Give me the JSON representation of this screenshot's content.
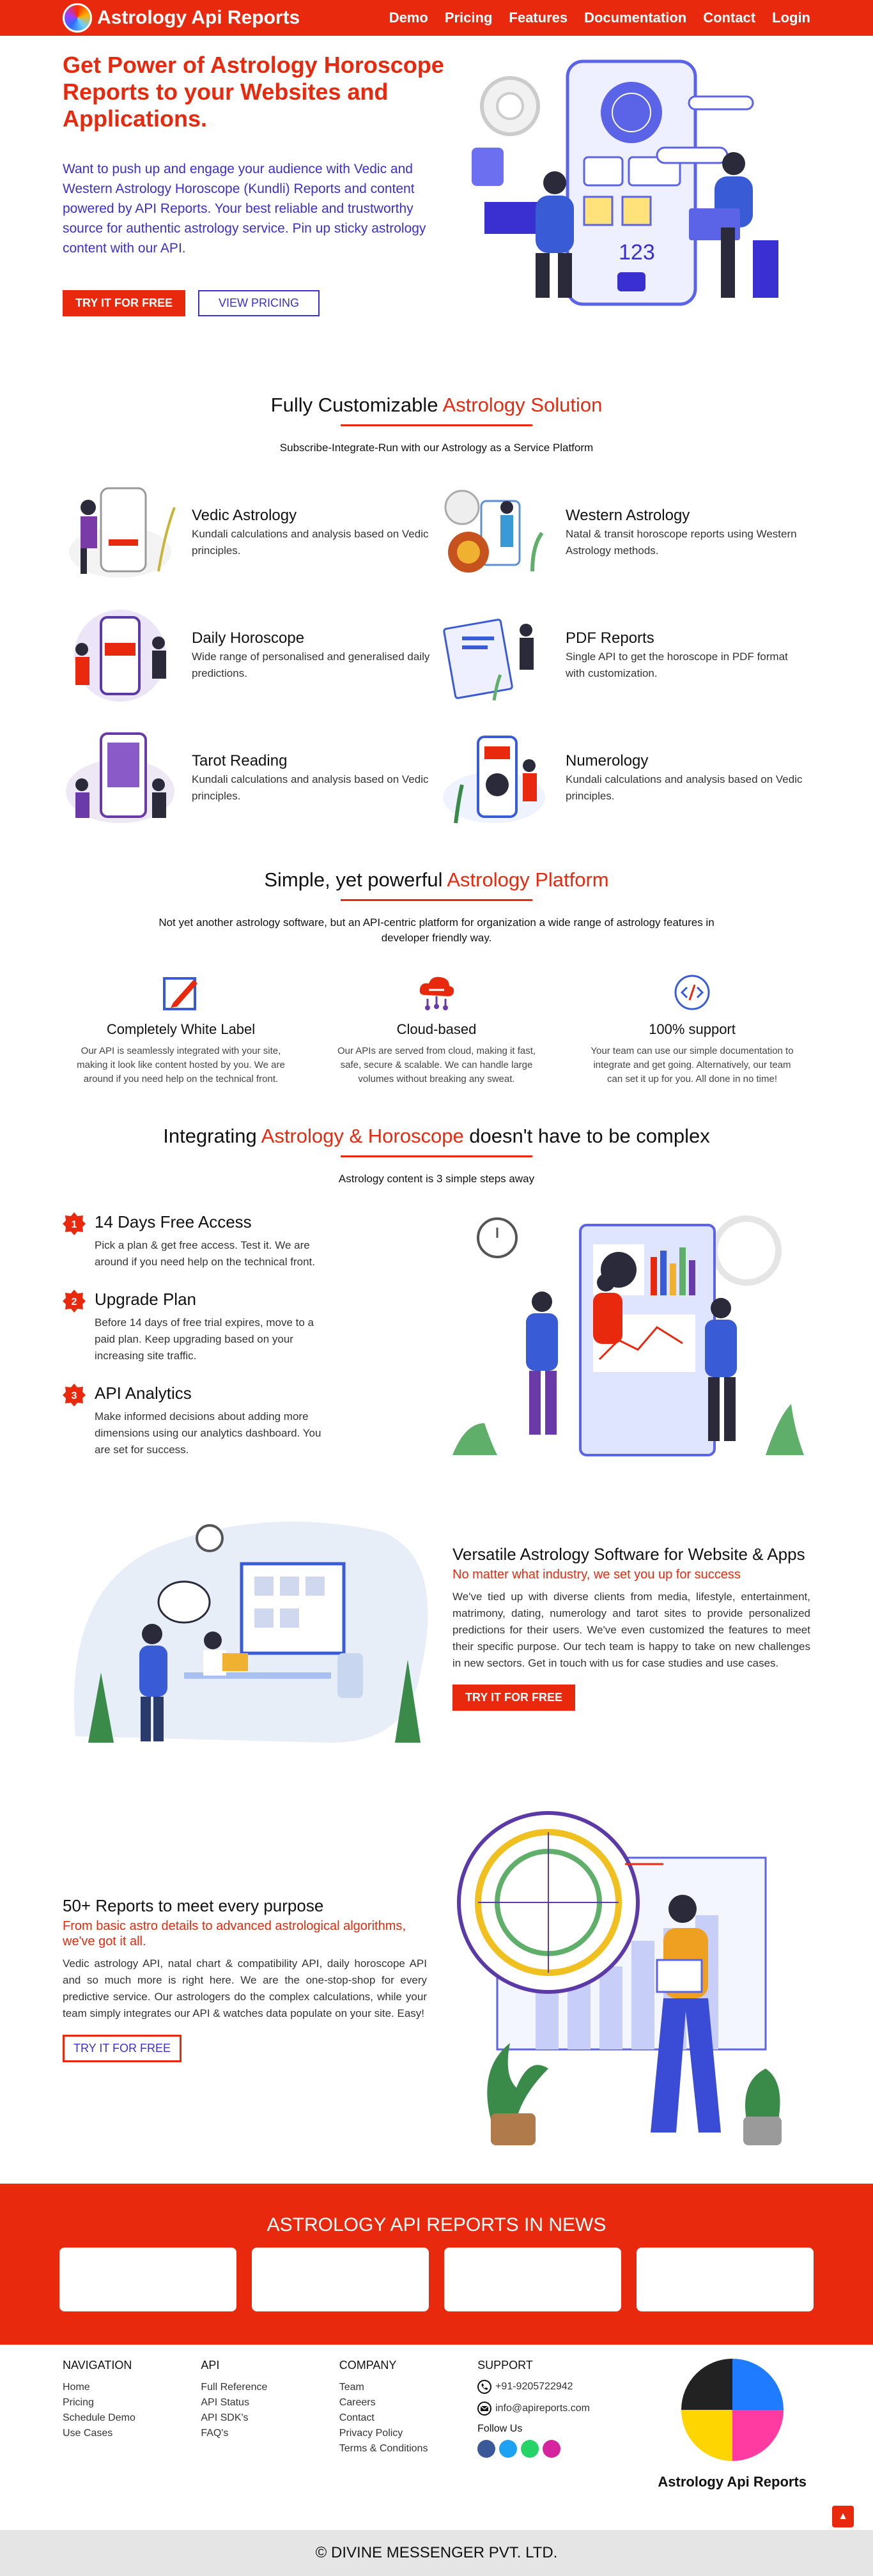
{
  "nav": {
    "brand": "Astrology Api Reports",
    "links": [
      "Demo",
      "Pricing",
      "Features",
      "Documentation",
      "Contact",
      "Login"
    ]
  },
  "hero": {
    "title": "Get Power of Astrology Horoscope Reports to your Websites and Applications.",
    "description": "Want to push up and engage your audience with Vedic and Western Astrology Horoscope (Kundli) Reports and content powered by API Reports. Your best reliable and trustworthy source for authentic astrology service. Pin up sticky astrology content with our API.",
    "btn_try": "TRY IT FOR FREE",
    "btn_pricing": "VIEW PRICING",
    "illustration_text": "123"
  },
  "solutions": {
    "title_plain": "Fully Customizable ",
    "title_accent": "Astrology Solution",
    "subtitle": "Subscribe-Integrate-Run with our Astrology as a Service Platform",
    "items": [
      {
        "title": "Vedic Astrology",
        "desc": "Kundali calculations and analysis based on Vedic principles."
      },
      {
        "title": "Western Astrology",
        "desc": "Natal & transit horoscope reports using Western Astrology methods."
      },
      {
        "title": "Daily Horoscope",
        "desc": "Wide range of personalised and generalised daily predictions."
      },
      {
        "title": "PDF Reports",
        "desc": "Single API to get the horoscope in PDF format with customization."
      },
      {
        "title": "Tarot Reading",
        "desc": "Kundali calculations and analysis based on Vedic principles."
      },
      {
        "title": "Numerology",
        "desc": "Kundali calculations and analysis based on Vedic principles."
      }
    ]
  },
  "platform": {
    "title_plain": "Simple, yet powerful ",
    "title_accent": "Astrology Platform",
    "subtitle": "Not yet another astrology software, but an API-centric platform for organization a wide range of astrology features in developer friendly way.",
    "items": [
      {
        "icon": "pencil-icon",
        "title": "Completely White Label",
        "desc": "Our API is seamlessly integrated with your site, making it look like content hosted by you. We are around if you need help on the technical front."
      },
      {
        "icon": "cloud-icon",
        "title": "Cloud-based",
        "desc": "Our APIs are served from cloud, making it fast, safe, secure & scalable. We can handle large volumes without breaking any sweat."
      },
      {
        "icon": "code-icon",
        "title": "100% support",
        "desc": "Your team can use our simple documentation to integrate and get going. Alternatively, our team can set it up for you. All done in no time!"
      }
    ]
  },
  "steps": {
    "title_plain_1": "Integrating ",
    "title_accent": "Astrology & Horoscope",
    "title_plain_2": " doesn't have to be complex",
    "subtitle": "Astrology content is 3 simple steps away",
    "items": [
      {
        "num": "1",
        "title": "14 Days Free Access",
        "desc": "Pick a plan & get free access. Test it. We are around if you need help on the technical front."
      },
      {
        "num": "2",
        "title": "Upgrade Plan",
        "desc": "Before 14 days of free trial expires, move to a paid plan. Keep upgrading based on your increasing site traffic."
      },
      {
        "num": "3",
        "title": "API Analytics",
        "desc": "Make informed decisions about adding more dimensions using our analytics dashboard. You are set for success."
      }
    ]
  },
  "versatile": {
    "title": "Versatile Astrology Software for Website & Apps",
    "subtitle": "No matter what industry, we set you up for success",
    "desc": "We've tied up with diverse clients from media, lifestyle, entertainment, matrimony, dating, numerology and tarot sites to provide personalized predictions for their users. We've even customized the features to meet their specific purpose. Our tech team is happy to take on new challenges in new sectors. Get in touch with us for case studies and use cases.",
    "btn": "TRY IT FOR FREE"
  },
  "reports": {
    "title": "50+ Reports to meet every purpose",
    "subtitle": "From basic astro details to advanced astrological algorithms, we've got it all.",
    "desc": "Vedic astrology API, natal chart & compatibility API, daily horoscope API and so much more is right here. We are the one-stop-shop for every predictive service. Our astrologers do the complex calculations, while your team simply integrates our API & watches data populate on your site. Easy!",
    "btn": "TRY IT FOR FREE"
  },
  "news": {
    "title": "ASTROLOGY API REPORTS IN NEWS"
  },
  "footer": {
    "navigation": {
      "title": "NAVIGATION",
      "links": [
        "Home",
        "Pricing",
        "Schedule Demo",
        "Use Cases"
      ]
    },
    "api": {
      "title": "API",
      "links": [
        "Full Reference",
        "API Status",
        "API SDK's",
        "FAQ's"
      ]
    },
    "company": {
      "title": "COMPANY",
      "links": [
        "Team",
        "Careers",
        "Contact",
        "Privacy Policy",
        "Terms & Conditions"
      ]
    },
    "support": {
      "title": "SUPPORT",
      "phone": "+91-9205722942",
      "email": "info@apireports.com",
      "follow": "Follow Us"
    },
    "logo_name": "Astrology Api Reports"
  },
  "copyright": "© DIVINE MESSENGER PVT. LTD."
}
